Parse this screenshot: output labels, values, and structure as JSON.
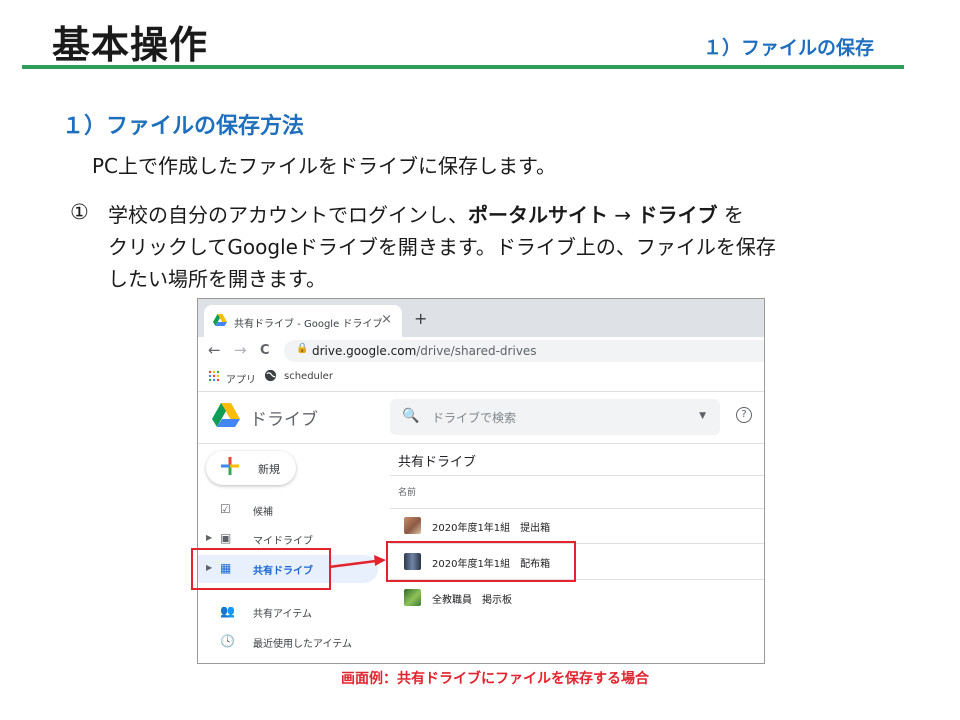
{
  "header": {
    "title": "基本操作",
    "subtitle": "１）ファイルの保存",
    "rule_color": "#2e9e5b"
  },
  "section": {
    "heading": "１）ファイルの保存方法",
    "intro": "PC上で作成したファイルをドライブに保存します。",
    "step_number": "①",
    "step_text_1": "学校の自分のアカウントでログインし、",
    "step_bold_1": "ポータルサイト",
    "step_arrow": " → ",
    "step_bold_2": "ドライブ",
    "step_text_2": " を",
    "step_line_2": "クリックしてGoogleドライブを開きます。ドライブ上の、ファイルを保存",
    "step_line_3": "したい場所を開きます。"
  },
  "browser": {
    "tab_title": "共有ドライブ - Google ドライブ",
    "tab_close": "×",
    "new_tab": "+",
    "back": "←",
    "forward": "→",
    "reload": "C",
    "url_host": "drive.google.com",
    "url_path": "/drive/shared-drives",
    "bookmarks": [
      {
        "label": "アプリ",
        "icon": "apps-grid-icon"
      },
      {
        "label": "scheduler",
        "icon": "globe-icon"
      }
    ]
  },
  "drive": {
    "app_label": "ドライブ",
    "search_placeholder": "ドライブで検索",
    "help": "?",
    "new_button": "新規",
    "sidebar": [
      {
        "label": "候補",
        "icon": "check-square-icon",
        "expandable": false
      },
      {
        "label": "マイドライブ",
        "icon": "my-drive-icon",
        "expandable": true
      },
      {
        "label": "共有ドライブ",
        "icon": "shared-drive-icon",
        "expandable": true,
        "active": true
      },
      {
        "label": "共有アイテム",
        "icon": "people-icon",
        "expandable": false
      },
      {
        "label": "最近使用したアイテム",
        "icon": "clock-icon",
        "expandable": false
      }
    ],
    "content_title": "共有ドライブ",
    "column_name": "名前",
    "rows": [
      {
        "name": "2020年度1年1組　提出箱"
      },
      {
        "name": "2020年度1年1組　配布箱"
      },
      {
        "name": "全教職員　掲示板"
      }
    ]
  },
  "caption": "画面例：共有ドライブにファイルを保存する場合",
  "colors": {
    "accent_blue": "#1f6fbf",
    "highlight_red": "#e3232d"
  }
}
